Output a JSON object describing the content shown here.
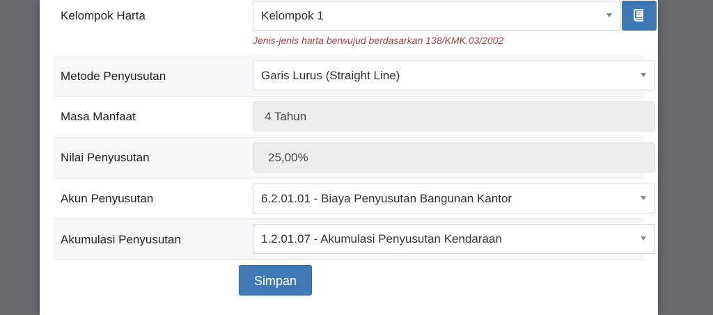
{
  "form": {
    "kelompok": {
      "label": "Kelompok Harta",
      "value": "Kelompok 1",
      "help": "Jenis-jenis harta berwujud berdasarkan 138/KMK.03/2002"
    },
    "metode": {
      "label": "Metode Penyusutan",
      "value": "Garis Lurus (Straight Line)"
    },
    "masa": {
      "label": "Masa Manfaat",
      "value": "4 Tahun"
    },
    "nilai": {
      "label": "Nilai Penyusutan",
      "value": "25,00%"
    },
    "akun": {
      "label": "Akun Penyusutan",
      "value": "6.2.01.01 - Biaya Penyusutan Bangunan Kantor"
    },
    "akumulasi": {
      "label": "Akumulasi Penyusutan",
      "value": "1.2.01.07 - Akumulasi Penyusutan Kendaraan"
    },
    "save_label": "Simpan"
  },
  "icons": {
    "reference": "book-icon",
    "dropdown": "caret-down-icon"
  },
  "colors": {
    "primary": "#3f7ab6",
    "help_text": "#a94442",
    "readonly_bg": "#eeeeee"
  }
}
